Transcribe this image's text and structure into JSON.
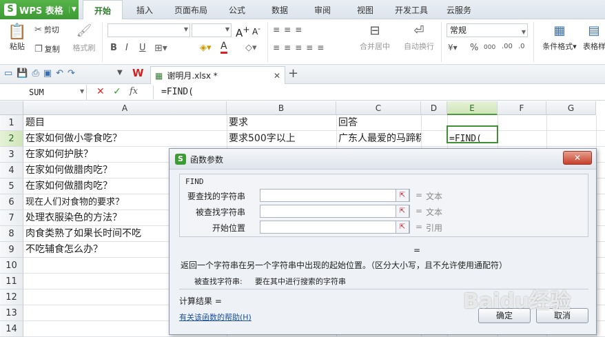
{
  "app": {
    "name": "WPS 表格",
    "logo": "S"
  },
  "tabs": [
    "开始",
    "插入",
    "页面布局",
    "公式",
    "数据",
    "审阅",
    "视图",
    "开发工具",
    "云服务"
  ],
  "active_tab": "开始",
  "ribbon": {
    "paste": "粘贴",
    "cut": "剪切",
    "copy": "复制",
    "format_painter": "格式刷",
    "merge_center": "合并居中",
    "wrap_text": "自动换行",
    "number_format": "常规",
    "percent": "%",
    "thousands": "000",
    "cond_format": "条件格式",
    "table_style": "表格样",
    "bold": "B",
    "italic": "I",
    "underline": "U",
    "font_grow": "A",
    "font_shrink": "A",
    "font_color": "A"
  },
  "doc_tab": {
    "name": "谢明月.xlsx *"
  },
  "formula_bar": {
    "name_box": "SUM",
    "fx": "fx",
    "formula": "=FIND("
  },
  "columns": [
    "A",
    "B",
    "C",
    "D",
    "E",
    "F",
    "G"
  ],
  "selected_column": "E",
  "rows": [
    {
      "num": "1",
      "a": "题目",
      "b": "要求",
      "c": "回答",
      "e": ""
    },
    {
      "num": "2",
      "a": "在家如何做小零食吃？",
      "b": "要求500字以上",
      "c": "广东人最爱的马蹄糕是",
      "e": "=FIND("
    },
    {
      "num": "3",
      "a": "在家如何护肤？",
      "b": "",
      "c": "",
      "e": ""
    },
    {
      "num": "4",
      "a": "在家如何做腊肉吃？",
      "b": "",
      "c": "",
      "e": ""
    },
    {
      "num": "5",
      "a": "在家如何做腊肉吃？",
      "b": "",
      "c": "",
      "e": ""
    },
    {
      "num": "6",
      "a": "现在人们对食物的要求？",
      "b": "",
      "c": "",
      "e": ""
    },
    {
      "num": "7",
      "a": "处理衣服染色的方法？",
      "b": "",
      "c": "",
      "e": ""
    },
    {
      "num": "8",
      "a": "肉食类熟了如果长时间不吃",
      "b": "",
      "c": "",
      "e": ""
    },
    {
      "num": "9",
      "a": "不吃辅食怎么办？",
      "b": "",
      "c": "",
      "e": ""
    },
    {
      "num": "10",
      "a": "",
      "b": "",
      "c": "",
      "e": ""
    },
    {
      "num": "11",
      "a": "",
      "b": "",
      "c": "",
      "e": ""
    },
    {
      "num": "12",
      "a": "",
      "b": "",
      "c": "",
      "e": ""
    },
    {
      "num": "13",
      "a": "",
      "b": "",
      "c": "",
      "e": ""
    },
    {
      "num": "14",
      "a": "",
      "b": "",
      "c": "",
      "e": ""
    }
  ],
  "dialog": {
    "title": "函数参数",
    "function_name": "FIND",
    "params": [
      {
        "label": "要查找的字符串",
        "value": "",
        "result": "文本"
      },
      {
        "label": "被查找字符串",
        "value": "",
        "result": "文本"
      },
      {
        "label": "开始位置",
        "value": "",
        "result": "引用"
      }
    ],
    "eq": "=",
    "description": "返回一个字符串在另一个字符串中出现的起始位置。（区分大小写，且不允许使用通配符）",
    "param_help_label": "被查找字符串:",
    "param_help_text": "要在其中进行搜索的字符串",
    "result_label": "计算结果 =",
    "help_link": "有关该函数的帮助(H)",
    "ok": "确定",
    "cancel": "取消"
  },
  "watermark": "Baidu经验"
}
